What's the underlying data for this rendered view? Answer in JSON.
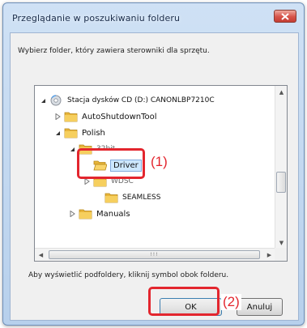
{
  "window": {
    "title": "Przeglądanie w poszukiwaniu folderu",
    "prompt": "Wybierz folder, który zawiera sterowniki dla sprzętu.",
    "hint": "Aby wyświetlić podfoldery, kliknij symbol obok folderu."
  },
  "tree": {
    "nodes": [
      {
        "label": "Stacja dysków CD (D:) CANONLBP7210C",
        "icon": "cd-drive-icon",
        "expander": "expanded"
      },
      {
        "label": "AutoShutdownTool",
        "icon": "folder-icon",
        "expander": "collapsed"
      },
      {
        "label": "Polish",
        "icon": "folder-icon",
        "expander": "expanded"
      },
      {
        "label": "32bit",
        "icon": "folder-icon",
        "expander": "expanded"
      },
      {
        "label": "Driver",
        "icon": "folder-open-icon",
        "expander": "none",
        "selected": true
      },
      {
        "label": "WDSC",
        "icon": "folder-icon",
        "expander": "collapsed"
      },
      {
        "label": "SEAMLESS",
        "icon": "folder-icon",
        "expander": "none"
      },
      {
        "label": "Manuals",
        "icon": "folder-icon",
        "expander": "collapsed"
      }
    ],
    "scrollbar_grip": "!!!"
  },
  "buttons": {
    "ok_label": "OK",
    "cancel_label": "Anuluj"
  },
  "callouts": {
    "first": "(1)",
    "second": "(2)"
  },
  "colors": {
    "callout": "#e3262e",
    "selection": "#cde8ff",
    "titlebar": "#c4d9f0",
    "close_button": "#d6534a"
  }
}
